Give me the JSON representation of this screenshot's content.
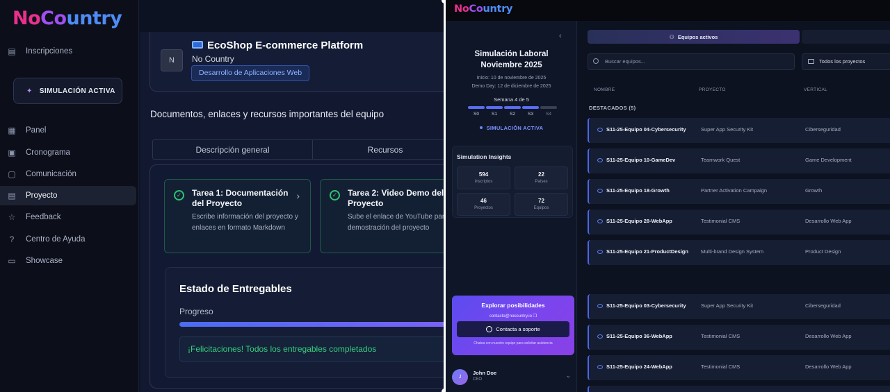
{
  "left": {
    "logo": {
      "part1": "No",
      "part2": "Co",
      "part3": "untry"
    },
    "sidebar": {
      "items_top": [
        {
          "label": "Inscripciones",
          "icon": "clipboard-icon"
        }
      ],
      "sim_button": "SIMULACIÓN ACTIVA",
      "items": [
        {
          "label": "Panel",
          "icon": "grid-icon"
        },
        {
          "label": "Cronograma",
          "icon": "calendar-icon"
        },
        {
          "label": "Comunicación",
          "icon": "chat-icon"
        },
        {
          "label": "Proyecto",
          "icon": "document-icon",
          "active": true
        },
        {
          "label": "Feedback",
          "icon": "star-icon"
        },
        {
          "label": "Centro de Ayuda",
          "icon": "help-icon"
        },
        {
          "label": "Showcase",
          "icon": "monitor-icon"
        }
      ]
    },
    "project": {
      "avatar": "N",
      "title": "EcoShop E-commerce Platform",
      "org": "No Country",
      "tag": "Desarrollo de Aplicaciones Web"
    },
    "docs_heading": "Documentos, enlaces y recursos importantes del equipo",
    "tabs": [
      "Descripción general",
      "Recursos"
    ],
    "tasks": [
      {
        "title": "Tarea 1: Documentación del Proyecto",
        "desc": "Escribe información del proyecto y enlaces en formato Markdown"
      },
      {
        "title": "Tarea 2: Video Demo del Proyecto",
        "desc": "Sube el enlace de YouTube para la demostración del proyecto"
      }
    ],
    "deliverables": {
      "title": "Estado de Entregables",
      "progress_label": "Progreso",
      "progress": 1.0,
      "message": "¡Felicitaciones! Todos los entregables completados"
    }
  },
  "right": {
    "logo": {
      "part1": "No",
      "part2": "Co",
      "part3": "untry"
    },
    "sidebar": {
      "sim_title_1": "Simulación Laboral",
      "sim_title_2": "Noviembre 2025",
      "start": "Inicio: 10 de noviembre de 2025",
      "demo_day": "Demo Day: 12 de diciembre de 2025",
      "week": "Semana 4 de 5",
      "weeks": [
        {
          "label": "S0",
          "done": true
        },
        {
          "label": "S1",
          "done": true
        },
        {
          "label": "S2",
          "done": true
        },
        {
          "label": "S3",
          "done": true
        },
        {
          "label": "S4",
          "done": false
        }
      ],
      "status": "SIMULACIÓN ACTIVA",
      "insights_title": "Simulation Insights",
      "stats": [
        {
          "value": "594",
          "label": "Inscriptos"
        },
        {
          "value": "22",
          "label": "Países"
        },
        {
          "value": "46",
          "label": "Proyectos"
        },
        {
          "value": "72",
          "label": "Equipos"
        }
      ],
      "explore": {
        "title": "Explorar posibilidades",
        "email": "contacto@nocountry.io",
        "button": "Contacta a soporte",
        "note": "Chatea con nuestro equipo para solicitar asistencia"
      },
      "user": {
        "name": "John Doe",
        "role": "CEO",
        "initial": "J"
      }
    },
    "main": {
      "tab_active": "Equipos activos",
      "search_placeholder": "Buscar equipos...",
      "filter": "Todos los proyectos",
      "columns": [
        "NOMBRE",
        "PROYECTO",
        "VERTICAL"
      ],
      "featured_label": "DESTACADOS (5)",
      "featured": [
        {
          "name": "S11-25-Equipo 04-Cybersecurity",
          "project": "Super App Security Kit",
          "vertical": "Ciberseguridad"
        },
        {
          "name": "S11-25-Equipo 10-GameDev",
          "project": "Teamwork Quest",
          "vertical": "Game Development"
        },
        {
          "name": "S11-25-Equipo 18-Growth",
          "project": "Partner Activation Campaign",
          "vertical": "Growth"
        },
        {
          "name": "S11-25-Equipo 28-WebApp",
          "project": "Testimonial CMS",
          "vertical": "Desarrollo Web App"
        },
        {
          "name": "S11-25-Equipo 21-ProductDesign",
          "project": "Multi-brand Design System",
          "vertical": "Product Design"
        }
      ],
      "rest": [
        {
          "name": "S11-25-Equipo 03-Cybersecurity",
          "project": "Super App Security Kit",
          "vertical": "Ciberseguridad"
        },
        {
          "name": "S11-25-Equipo 36-WebApp",
          "project": "Testimonial CMS",
          "vertical": "Desarrollo Web App"
        },
        {
          "name": "S11-25-Equipo 24-WebApp",
          "project": "Testimonial CMS",
          "vertical": "Desarrollo Web App"
        }
      ]
    }
  }
}
